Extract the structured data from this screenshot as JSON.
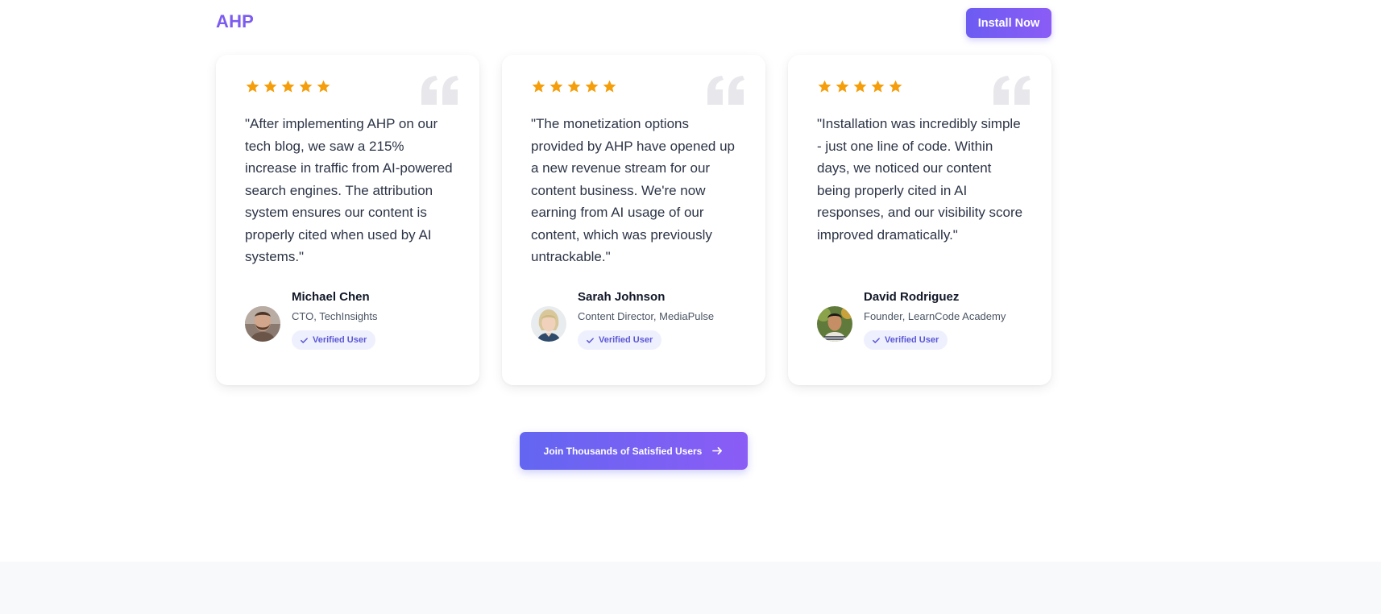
{
  "header": {
    "logo": "AHP",
    "install_button": "Install Now"
  },
  "colors": {
    "brand": "#7c5cf0",
    "star": "#f59e0b",
    "badge_text": "#5b57d6"
  },
  "testimonials": [
    {
      "rating": 5,
      "quote": "\"After implementing AHP on our tech blog, we saw a 215% increase in traffic from AI-powered search engines. The attribution system ensures our content is properly cited when used by AI systems.\"",
      "name": "Michael Chen",
      "role": "CTO, TechInsights",
      "badge": "Verified User",
      "avatar_icon": "avatar-man-beard"
    },
    {
      "rating": 5,
      "quote": "\"The monetization options provided by AHP have opened up a new revenue stream for our content business. We're now earning from AI usage of our content, which was previously untrackable.\"",
      "name": "Sarah Johnson",
      "role": "Content Director, MediaPulse",
      "badge": "Verified User",
      "avatar_icon": "avatar-woman-blonde"
    },
    {
      "rating": 5,
      "quote": "\"Installation was incredibly simple - just one line of code. Within days, we noticed our content being properly cited in AI responses, and our visibility score improved dramatically.\"",
      "name": "David Rodriguez",
      "role": "Founder, LearnCode Academy",
      "badge": "Verified User",
      "avatar_icon": "avatar-man-outdoor"
    }
  ],
  "cta": {
    "label": "Join Thousands of Satisfied Users"
  }
}
